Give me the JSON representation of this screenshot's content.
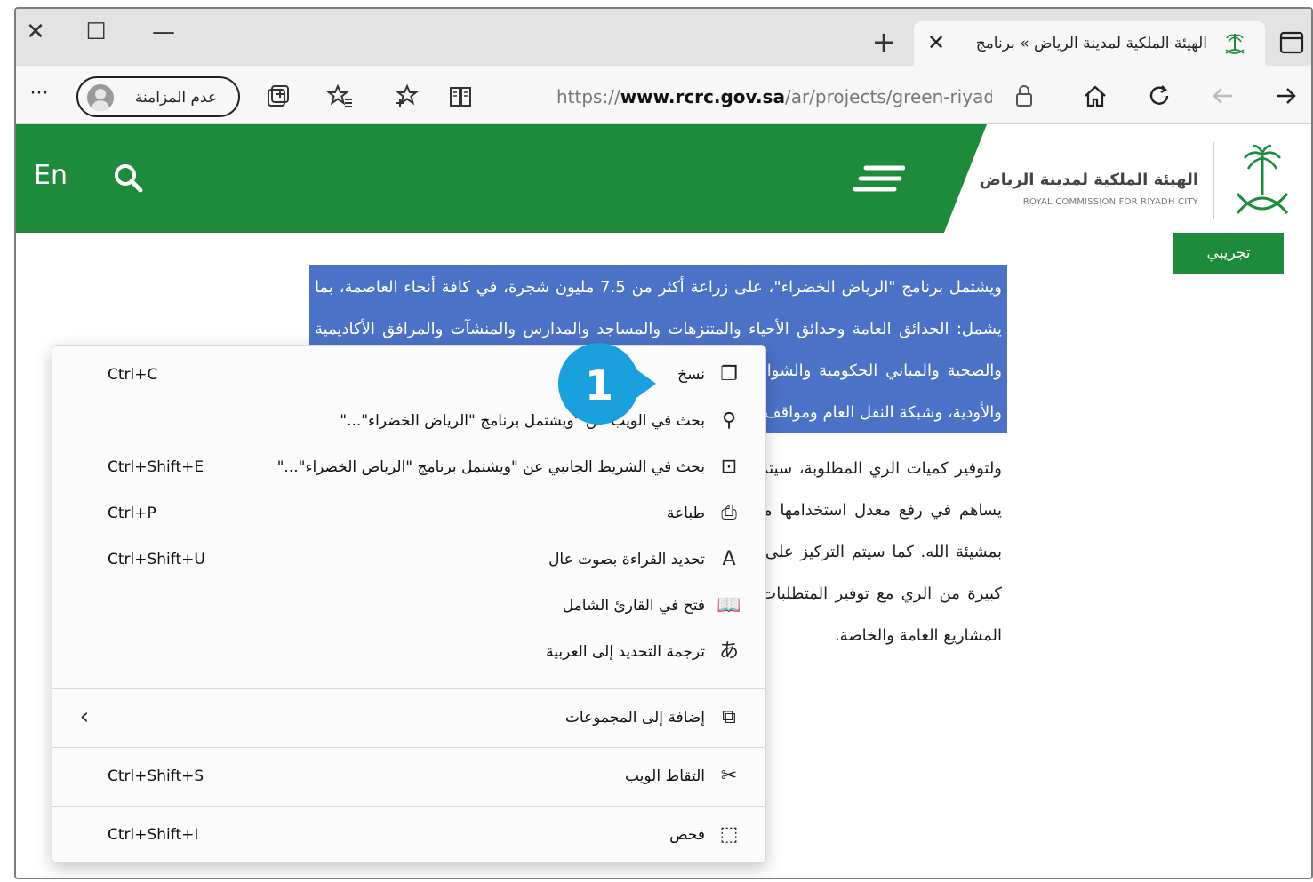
{
  "window": {
    "close_glyph": "✕",
    "maximize_glyph": "☐",
    "minimize_glyph": "—"
  },
  "tab": {
    "title": "الهيئة الملكية لمدينة الرياض » برنامج",
    "close_glyph": "✕"
  },
  "new_tab_glyph": "+",
  "toolbar": {
    "url_prefix": "https://",
    "url_domain": "www.rcrc.gov.sa",
    "url_path": "/ar/projects/green-riyadh",
    "inprivate_label": "عدم المزامنة",
    "more_glyph": "···"
  },
  "site": {
    "lang_link": "En",
    "logo_title": "الهيئة الملكية لمدينة الرياض",
    "logo_subtitle": "ROYAL COMMISSION FOR RIYADH CITY",
    "beta_badge": "تجريبي",
    "brand_green": "#1d8a3c"
  },
  "article": {
    "selected_text": "ويشتمل برنامج \"الرياض الخضراء\"، على زراعة أكثر من 7.5 مليون شجرة، في كافة أنحاء العاصمة، بما يشمل: الحدائق العامة وحدائق الأحياء والمتنزهات والمساجد والمدارس والمنشآت والمرافق الأكاديمية والصحية والمباني الحكومية والشوارع والطرق والمواقف العامة، إضافة إلى مطار الملك خالد الدولي والأودية، وشبكة النقل العام ومواقف السيارات والأراضي الفضاء.",
    "body_text": "ولتوفير كميات الري المطلوبة، سيتم إنشاء شبكات جديدة باستخدام المياه المعالجة، ومياه الأودية، مما يساهم في رفع معدل استخدامها من ٩٠ ألف متر مكعب حالياً، إلى أكثر من مليون متر مكعب يومياً بمشيئة الله. كما سيتم التركيز على اختيار الأشجار المحلية ذات الظل الكثيف التي لا تحتاج إلى كميات كبيرة من الري مع توفير المتطلبات اللازمة لتغذية المشروع بالشتلات والشجيرات لتعزيز التشجير في المشاريع العامة والخاصة.",
    "selection_color": "#4c72c8"
  },
  "context_menu": {
    "items": [
      {
        "label": "نسخ",
        "shortcut": "Ctrl+C",
        "icon": "copy-icon",
        "glyph": "❐"
      },
      {
        "label": "بحث في الويب عن \"ويشتمل برنامج \"الرياض الخضراء\"...\"",
        "shortcut": "",
        "icon": "search-icon",
        "glyph": "⚲"
      },
      {
        "label": "بحث في الشريط الجانبي عن \"ويشتمل برنامج \"الرياض الخضراء\"...\"",
        "shortcut": "Ctrl+Shift+E",
        "icon": "sidebar-search-icon",
        "glyph": "⊡"
      },
      {
        "label": "طباعة",
        "shortcut": "Ctrl+P",
        "icon": "print-icon",
        "glyph": "⎙"
      },
      {
        "label": "تحديد القراءة بصوت عال",
        "shortcut": "Ctrl+Shift+U",
        "icon": "read-aloud-icon",
        "glyph": "A"
      },
      {
        "label": "فتح في القارئ الشامل",
        "shortcut": "",
        "icon": "immersive-reader-icon",
        "glyph": "📖"
      },
      {
        "label": "ترجمة التحديد إلى العربية",
        "shortcut": "",
        "icon": "translate-icon",
        "glyph": "あ"
      }
    ],
    "collections": {
      "label": "إضافة إلى المجموعات",
      "icon": "collections-icon",
      "glyph": "⧉",
      "chevron": "‹"
    },
    "capture": {
      "label": "التقاط الويب",
      "shortcut": "Ctrl+Shift+S",
      "icon": "web-capture-icon",
      "glyph": "✂"
    },
    "inspect": {
      "label": "فحص",
      "shortcut": "Ctrl+Shift+I",
      "icon": "inspect-icon",
      "glyph": "⬚"
    }
  },
  "callout": {
    "number": "1",
    "color": "#1aa0dc"
  }
}
